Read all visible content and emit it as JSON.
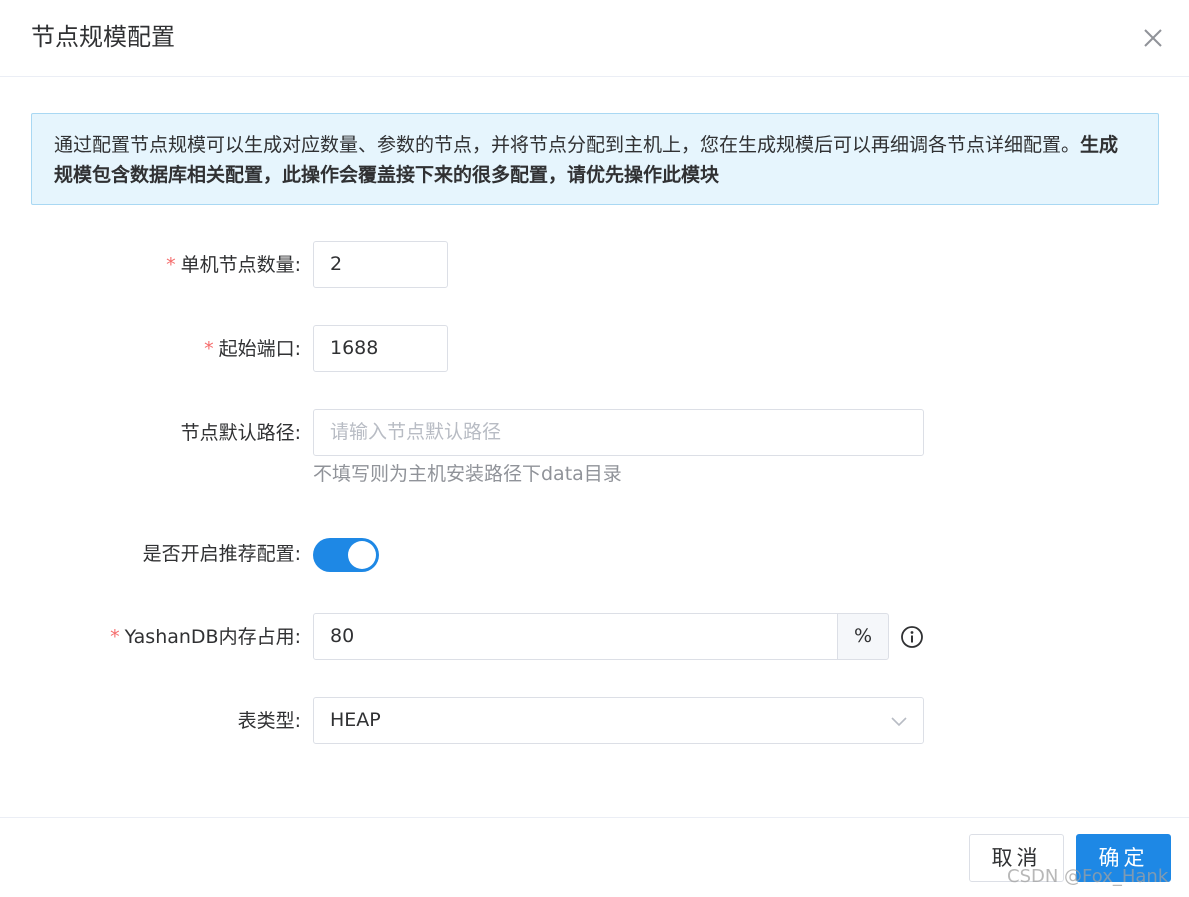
{
  "dialog": {
    "title": "节点规模配置",
    "close_icon": "close-icon"
  },
  "alert": {
    "text_normal": "通过配置节点规模可以生成对应数量、参数的节点，并将节点分配到主机上，您在生成规模后可以再细调各节点详细配置。",
    "text_bold": "生成规模包含数据库相关配置，此操作会覆盖接下来的很多配置，请优先操作此模块"
  },
  "form": {
    "required_mark": "*",
    "node_count": {
      "label": "单机节点数量:",
      "value": "2"
    },
    "start_port": {
      "label": "起始端口:",
      "value": "1688"
    },
    "default_path": {
      "label": "节点默认路径:",
      "placeholder": "请输入节点默认路径",
      "help": "不填写则为主机安装路径下data目录"
    },
    "recommend_config": {
      "label": "是否开启推荐配置:",
      "enabled": true
    },
    "memory_usage": {
      "label": "YashanDB内存占用:",
      "value": "80",
      "unit": "%",
      "icon": "info-icon"
    },
    "table_type": {
      "label": "表类型:",
      "value": "HEAP",
      "icon": "chevron-down-icon"
    }
  },
  "footer": {
    "cancel_label": "取消",
    "ok_label": "确定"
  },
  "watermark": "CSDN @Fox_Hank",
  "colors": {
    "primary": "#1e88e5",
    "required": "#f56c6c",
    "alert_bg": "#e6f5fd",
    "alert_border": "#a9d8f3"
  }
}
